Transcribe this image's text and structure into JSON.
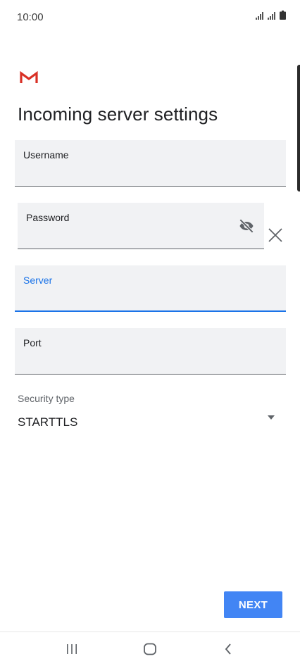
{
  "status_bar": {
    "time": "10:00",
    "icons": [
      "signal-icon",
      "signal-icon",
      "battery-icon"
    ]
  },
  "app": {
    "logo": "gmail-logo-icon"
  },
  "page": {
    "title": "Incoming server settings"
  },
  "form": {
    "username": {
      "label": "Username",
      "value": ""
    },
    "password": {
      "label": "Password",
      "value": "",
      "toggle_icon": "eye-off-icon",
      "clear_icon": "close-icon"
    },
    "server": {
      "label": "Server",
      "value": "",
      "focused": true
    },
    "port": {
      "label": "Port",
      "value": ""
    },
    "security": {
      "label": "Security type",
      "value": "STARTTLS",
      "icon": "dropdown-arrow-icon"
    }
  },
  "actions": {
    "next_label": "NEXT"
  },
  "nav_bar": {
    "icons": [
      "recent-apps-icon",
      "home-icon",
      "back-icon"
    ]
  },
  "colors": {
    "accent": "#1a73e8",
    "button": "#4285f4",
    "field_bg": "#f1f2f4",
    "gmail_red": "#d93025"
  }
}
